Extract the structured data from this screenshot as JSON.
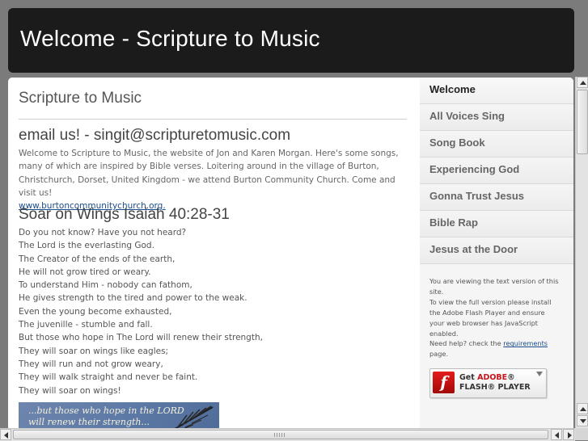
{
  "header": {
    "title": "Welcome - Scripture to Music"
  },
  "main": {
    "title": "Scripture to Music",
    "email_heading": "email us! - singit@scripturetomusic.com",
    "intro_text": "Welcome to Scripture to Music, the website of Jon and Karen Morgan. Here's some songs, many of which are inspired by Bible verses. Loitering around in the village of Burton, Christchurch, Dorset, United Kingdom - we attend Burton Community Church. Come and visit us!",
    "intro_link": "www.burtoncommunitychurch.org.",
    "song_heading": "Soar on Wings Isaiah 40:28-31",
    "lyrics": [
      "Do you not know? Have you not heard?",
      "The Lord is the everlasting God.",
      "The Creator of the ends of the earth,",
      "He will not grow tired or weary.",
      "To understand Him - nobody can fathom,",
      "He gives strength to the tired and power to the weak.",
      "Even the young become exhausted,",
      "The juvenille - stumble and fall.",
      "But those who hope in The Lord will renew their strength,",
      "They will soar on wings like eagles;",
      "They will run and not grow weary,",
      "They will walk straight and never be faint.",
      "They will soar on wings!"
    ],
    "image_caption_line1": "...but those who hope in the LORD",
    "image_caption_line2": "will renew their strength..."
  },
  "sidebar": {
    "items": [
      {
        "label": "Welcome"
      },
      {
        "label": "All Voices Sing"
      },
      {
        "label": "Song Book"
      },
      {
        "label": "Experiencing God"
      },
      {
        "label": "Gonna Trust Jesus"
      },
      {
        "label": "Bible Rap"
      },
      {
        "label": "Jesus at the Door"
      }
    ],
    "active_index": 0,
    "flash_note_1": "You are viewing the text version of this site.",
    "flash_note_2": "To view the full version please install the Adobe Flash Player and ensure your web browser has JavaScript enabled.",
    "flash_note_3a": "Need help? check the ",
    "flash_note_link": "requirements",
    "flash_note_3b": " page.",
    "flash_badge": {
      "logo_letter": "f",
      "line1_prefix": "Get ",
      "line1_brand": "ADOBE",
      "line1_reg": "®",
      "line2": "FLASH® PLAYER"
    }
  },
  "colors": {
    "page_bg": "#7b7b7b",
    "header_bg": "#1b1b1b",
    "link": "#1a4c8a",
    "adobe_red": "#c4161c"
  },
  "icons": {
    "scroll_up": "arrow-up-icon",
    "scroll_down": "arrow-down-icon",
    "scroll_left": "arrow-left-icon",
    "scroll_right": "arrow-right-icon",
    "flash_logo": "flash-logo-icon",
    "download": "download-arrow-icon"
  }
}
